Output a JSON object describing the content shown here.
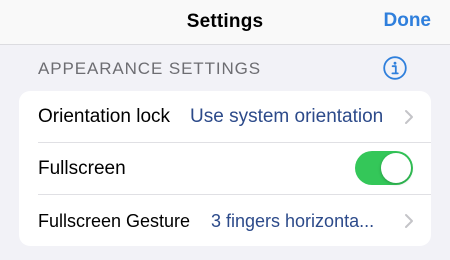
{
  "navbar": {
    "title": "Settings",
    "done_label": "Done"
  },
  "section": {
    "header": "APPEARANCE SETTINGS",
    "info_icon": "info-circle-icon"
  },
  "rows": [
    {
      "label": "Orientation lock",
      "value": "Use system orientation",
      "icon": "chevron-right-icon"
    },
    {
      "label": "Fullscreen",
      "toggle_on": true
    },
    {
      "label": "Fullscreen Gesture",
      "value": "3 fingers horizonta...",
      "icon": "chevron-right-icon"
    }
  ],
  "colors": {
    "accent": "#2f7fdc",
    "value_text": "#2c4a8a",
    "toggle_on": "#34c759",
    "background": "#f2f2f7"
  }
}
